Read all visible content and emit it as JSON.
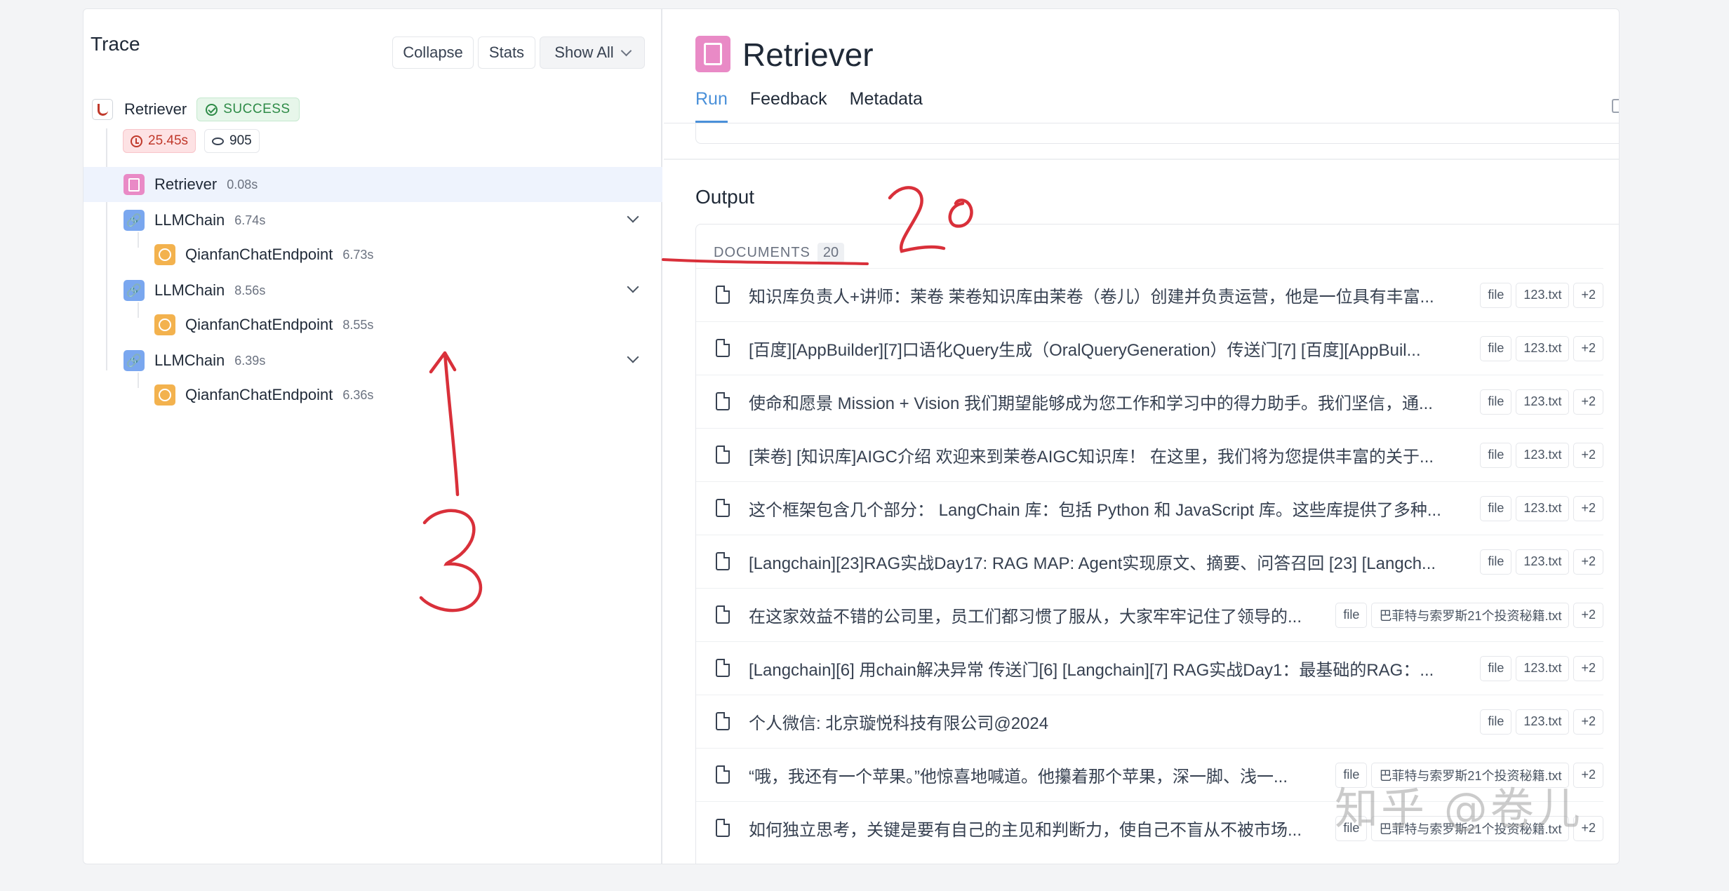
{
  "trace": {
    "title": "Trace",
    "collapse_label": "Collapse",
    "stats_label": "Stats",
    "show_all_label": "Show All",
    "root": {
      "name": "Retriever",
      "status": "SUCCESS",
      "latency": "25.45s",
      "tokens": "905"
    },
    "runs": [
      {
        "name": "Retriever",
        "time": "0.08s",
        "icon": "document-icon",
        "level": 1,
        "selected": true
      },
      {
        "name": "LLMChain",
        "time": "6.74s",
        "icon": "link-icon",
        "level": 1,
        "expandable": true
      },
      {
        "name": "QianfanChatEndpoint",
        "time": "6.73s",
        "icon": "llm-icon",
        "level": 2
      },
      {
        "name": "LLMChain",
        "time": "8.56s",
        "icon": "link-icon",
        "level": 1,
        "expandable": true
      },
      {
        "name": "QianfanChatEndpoint",
        "time": "8.55s",
        "icon": "llm-icon",
        "level": 2
      },
      {
        "name": "LLMChain",
        "time": "6.39s",
        "icon": "link-icon",
        "level": 1,
        "expandable": true
      },
      {
        "name": "QianfanChatEndpoint",
        "time": "6.36s",
        "icon": "llm-icon",
        "level": 2
      }
    ]
  },
  "detail": {
    "title": "Retriever",
    "tabs": [
      "Run",
      "Feedback",
      "Metadata"
    ],
    "active_tab": "Run",
    "output_label": "Output",
    "documents_label": "DOCUMENTS",
    "documents_count": "20",
    "documents": [
      {
        "text": "知识库负责人+讲师：茉卷 茉卷知识库由茉卷（卷儿）创建并负责运营，他是一位具有丰富...",
        "tags": [
          "file",
          "123.txt",
          "+2"
        ]
      },
      {
        "text": "[百度][AppBuilder][7]口语化Query生成（OralQueryGeneration）传送门[7] [百度][AppBuil...",
        "tags": [
          "file",
          "123.txt",
          "+2"
        ]
      },
      {
        "text": "使命和愿景 Mission + Vision 我们期望能够成为您工作和学习中的得力助手。我们坚信，通...",
        "tags": [
          "file",
          "123.txt",
          "+2"
        ]
      },
      {
        "text": "[茉卷] [知识库]AIGC介绍 欢迎来到茉卷AIGC知识库！ 在这里，我们将为您提供丰富的关于...",
        "tags": [
          "file",
          "123.txt",
          "+2"
        ]
      },
      {
        "text": "这个框架包含几个部分： LangChain 库：包括 Python 和 JavaScript 库。这些库提供了多种...",
        "tags": [
          "file",
          "123.txt",
          "+2"
        ]
      },
      {
        "text": "[Langchain][23]RAG实战Day17: RAG MAP: Agent实现原文、摘要、问答召回 [23] [Langch...",
        "tags": [
          "file",
          "123.txt",
          "+2"
        ]
      },
      {
        "text": "在这家效益不错的公司里，员工们都习惯了服从，大家牢牢记住了领导的...",
        "tags": [
          "file",
          "巴菲特与索罗斯21个投资秘籍.txt",
          "+2"
        ]
      },
      {
        "text": "[Langchain][6] 用chain解决异常 传送门[6] [Langchain][7] RAG实战Day1：最基础的RAG：...",
        "tags": [
          "file",
          "123.txt",
          "+2"
        ]
      },
      {
        "text": "个人微信: 北京璇悦科技有限公司@2024",
        "tags": [
          "file",
          "123.txt",
          "+2"
        ]
      },
      {
        "text": "“哦，我还有一个苹果。”他惊喜地喊道。他攥着那个苹果，深一脚、浅一...",
        "tags": [
          "file",
          "巴菲特与索罗斯21个投资秘籍.txt",
          "+2"
        ]
      },
      {
        "text": "如何独立思考，关键是要有自己的主见和判断力，使自己不盲从不被市场...",
        "tags": [
          "file",
          "巴菲特与索罗斯21个投资秘籍.txt",
          "+2"
        ]
      }
    ]
  },
  "watermark": "知乎 @卷儿",
  "colors": {
    "accent": "#4a90d9",
    "success": "#2e8b47",
    "latency": "#c0392b",
    "retriever_icon": "#e98ac6",
    "chain_icon": "#7aa7ef",
    "llm_icon": "#f3b24e",
    "annotation": "#d9303a"
  }
}
